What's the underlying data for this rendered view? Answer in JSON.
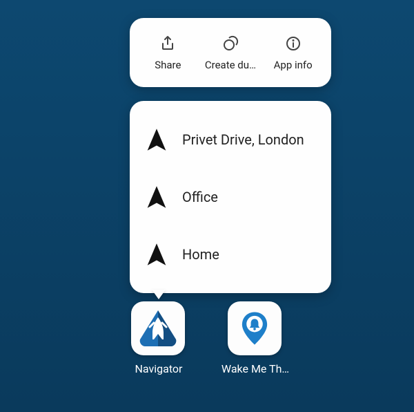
{
  "actions": {
    "share": {
      "label": "Share"
    },
    "dup": {
      "label": "Create du…"
    },
    "info": {
      "label": "App info"
    }
  },
  "shortcuts": [
    {
      "label": "Privet Drive, London"
    },
    {
      "label": "Office"
    },
    {
      "label": "Home"
    }
  ],
  "apps": {
    "navigator": {
      "label": "Navigator"
    },
    "wakeme": {
      "label": "Wake Me Th…"
    }
  }
}
